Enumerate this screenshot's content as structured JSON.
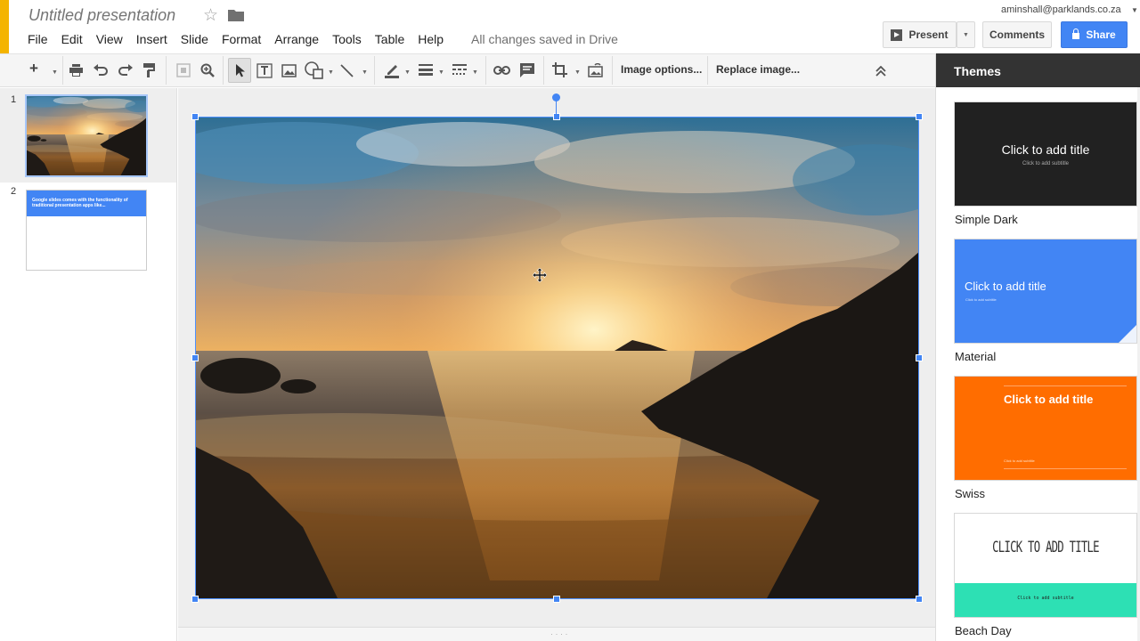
{
  "header": {
    "doc_title": "Untitled presentation",
    "save_status": "All changes saved in Drive",
    "account": "aminshall@parklands.co.za",
    "present_label": "Present",
    "comments_label": "Comments",
    "share_label": "Share"
  },
  "menu": [
    "File",
    "Edit",
    "View",
    "Insert",
    "Slide",
    "Format",
    "Arrange",
    "Tools",
    "Table",
    "Help"
  ],
  "toolbar": {
    "image_options_label": "Image options...",
    "replace_image_label": "Replace image..."
  },
  "filmstrip": {
    "slides": [
      {
        "number": "1"
      },
      {
        "number": "2",
        "text": "Google slides comes with the functionality of traditional presentation apps like..."
      }
    ]
  },
  "themes": {
    "title": "Themes",
    "items": [
      {
        "name": "Simple Dark",
        "title_text": "Click to add title",
        "subtitle_text": "Click to add subtitle",
        "bg": "#212121",
        "fg": "#ffffff"
      },
      {
        "name": "Material",
        "title_text": "Click to add title",
        "subtitle_text": "Click to add subtitle",
        "bg": "#4285f4",
        "fg": "#ffffff"
      },
      {
        "name": "Swiss",
        "title_text": "Click to add title",
        "subtitle_text": "Click to add subtitle",
        "bg": "#ff6d00",
        "fg": "#ffffff"
      },
      {
        "name": "Beach Day",
        "title_text": "Click to add title",
        "subtitle_text": "Click to add subtitle",
        "bg": "#ffffff",
        "fg": "#333333",
        "band": "#2de0b4"
      }
    ]
  },
  "colors": {
    "accent": "#4285f4",
    "share_button": "#4285f4",
    "logo": "#f4b400",
    "themes_header": "#333333"
  }
}
